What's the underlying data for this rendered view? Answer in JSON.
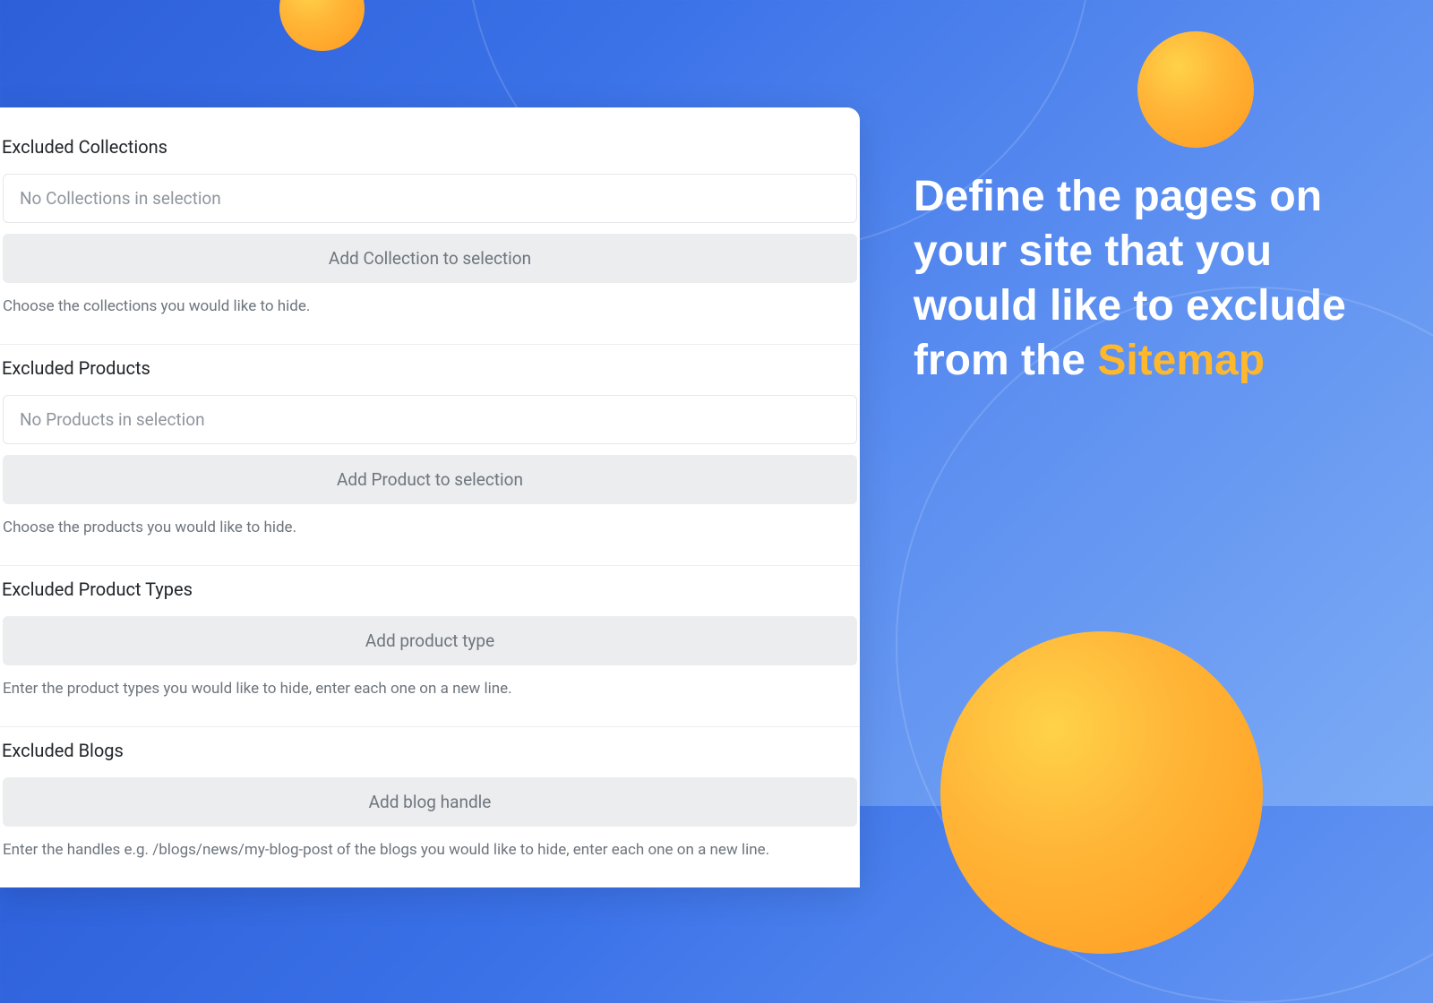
{
  "hero": {
    "line1": "Define the pages on your site that you would like to exclude from the ",
    "highlight": "Sitemap"
  },
  "sections": {
    "collections": {
      "title": "Excluded Collections",
      "empty": "No Collections in selection",
      "button": "Add Collection to selection",
      "help": "Choose the collections you would like to hide."
    },
    "products": {
      "title": "Excluded Products",
      "empty": "No Products in selection",
      "button": "Add Product to selection",
      "help": "Choose the products you would like to hide."
    },
    "productTypes": {
      "title": "Excluded Product Types",
      "button": "Add product type",
      "help": "Enter the product types you would like to hide, enter each one on a new line."
    },
    "blogs": {
      "title": "Excluded Blogs",
      "button": "Add blog handle",
      "help": "Enter the handles e.g. /blogs/news/my-blog-post of the blogs you would like to hide, enter each one on a new line."
    }
  }
}
